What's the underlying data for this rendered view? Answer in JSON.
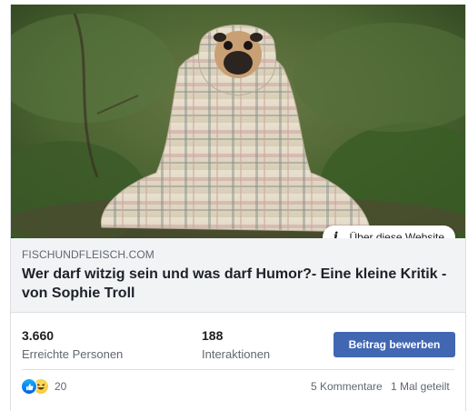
{
  "post": {
    "image_alt": "",
    "about_badge": "Über diese Website",
    "domain": "FISCHUNDFLEISCH.COM",
    "title": "Wer darf witzig sein und was darf Humor?- Eine kleine Kritik - von Sophie Troll"
  },
  "stats": {
    "reach_value": "3.660",
    "reach_label": "Erreichte Personen",
    "interactions_value": "188",
    "interactions_label": "Interaktionen",
    "boost_label": "Beitrag bewerben"
  },
  "reactions": {
    "icons": [
      "like-icon",
      "haha-icon"
    ],
    "count": "20",
    "comments": "5 Kommentare",
    "shares": "1 Mal geteilt"
  },
  "colors": {
    "accent": "#4267b2",
    "link_bg": "#f2f3f5",
    "secondary_text": "#606770",
    "primary_text": "#1d2129"
  }
}
